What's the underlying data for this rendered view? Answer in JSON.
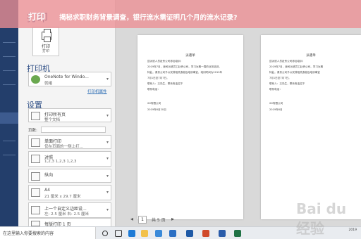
{
  "banner": {
    "tag": "打印",
    "title": "揭秘求职财务背景调查，银行流水需证明几个月的流水记录?"
  },
  "print_panel": {
    "print_button": {
      "label": "打印",
      "sublabel": "打印"
    },
    "printer": {
      "heading": "打印机",
      "name": "OneNote for Windo...",
      "status": "就绪",
      "properties_link": "打印机属性"
    },
    "settings": {
      "heading": "设置",
      "scope": {
        "primary": "打印所有页",
        "secondary": "整个文档"
      },
      "pages_label": "页数:",
      "pages_value": "",
      "sides": {
        "primary": "单面打印",
        "secondary": "仅在页面的一侧上打..."
      },
      "collate": {
        "primary": "对照",
        "secondary": "1,2,3    1,2,3    1,2,3"
      },
      "orientation": {
        "primary": "纵向",
        "secondary": ""
      },
      "paper": {
        "primary": "A4",
        "secondary": "21 厘米 x 29.7 厘米"
      },
      "margins": {
        "primary": "上一个自定义边距设...",
        "secondary": "左: 2.5 厘米  右: 2.5 厘米"
      },
      "per_sheet": {
        "primary": "每版打印 1 页",
        "secondary": ""
      }
    }
  },
  "preview": {
    "page1": {
      "title": "派遣单",
      "lines": [
        "兹派遣人员赴贵公司参加培训：",
        "    2019年7月，我司派遣员工赴贵公司，学习为期一周的业务培训，",
        "    特此，请贵公司予以安排相关食宿及培训事宜，培训时间为2019年",
        "    7月1日至7月7日。",
        "    联系人：王先生，联系电话如下",
        "    联系电话：",
        "                              XX有限公司",
        "                              2019年6月20日"
      ]
    },
    "page2": {
      "title": "派遣单",
      "lines": [
        "兹派遣人员赴贵公司参加培训：",
        "    2019年7月，我司派遣员工赴贵公司，学习为期",
        "    特此，请贵公司予以安排相关食宿及培训事宜",
        "    7月1日至7月7日。",
        "    联系人：王先生，联系电话如下",
        "    联系电话：",
        "                         XX有限公司",
        "                         2019年6月"
      ]
    },
    "nav": {
      "current": "1",
      "total": "共 5 页"
    }
  },
  "taskbar": {
    "search_text": "在这里输入你要搜索的内容",
    "time": "",
    "date": "2019"
  },
  "watermark": {
    "text": "Bai du 经验"
  },
  "colors": {
    "rail": "#233e6b",
    "accent": "#2f4f86",
    "banner": "#ec8e94"
  }
}
